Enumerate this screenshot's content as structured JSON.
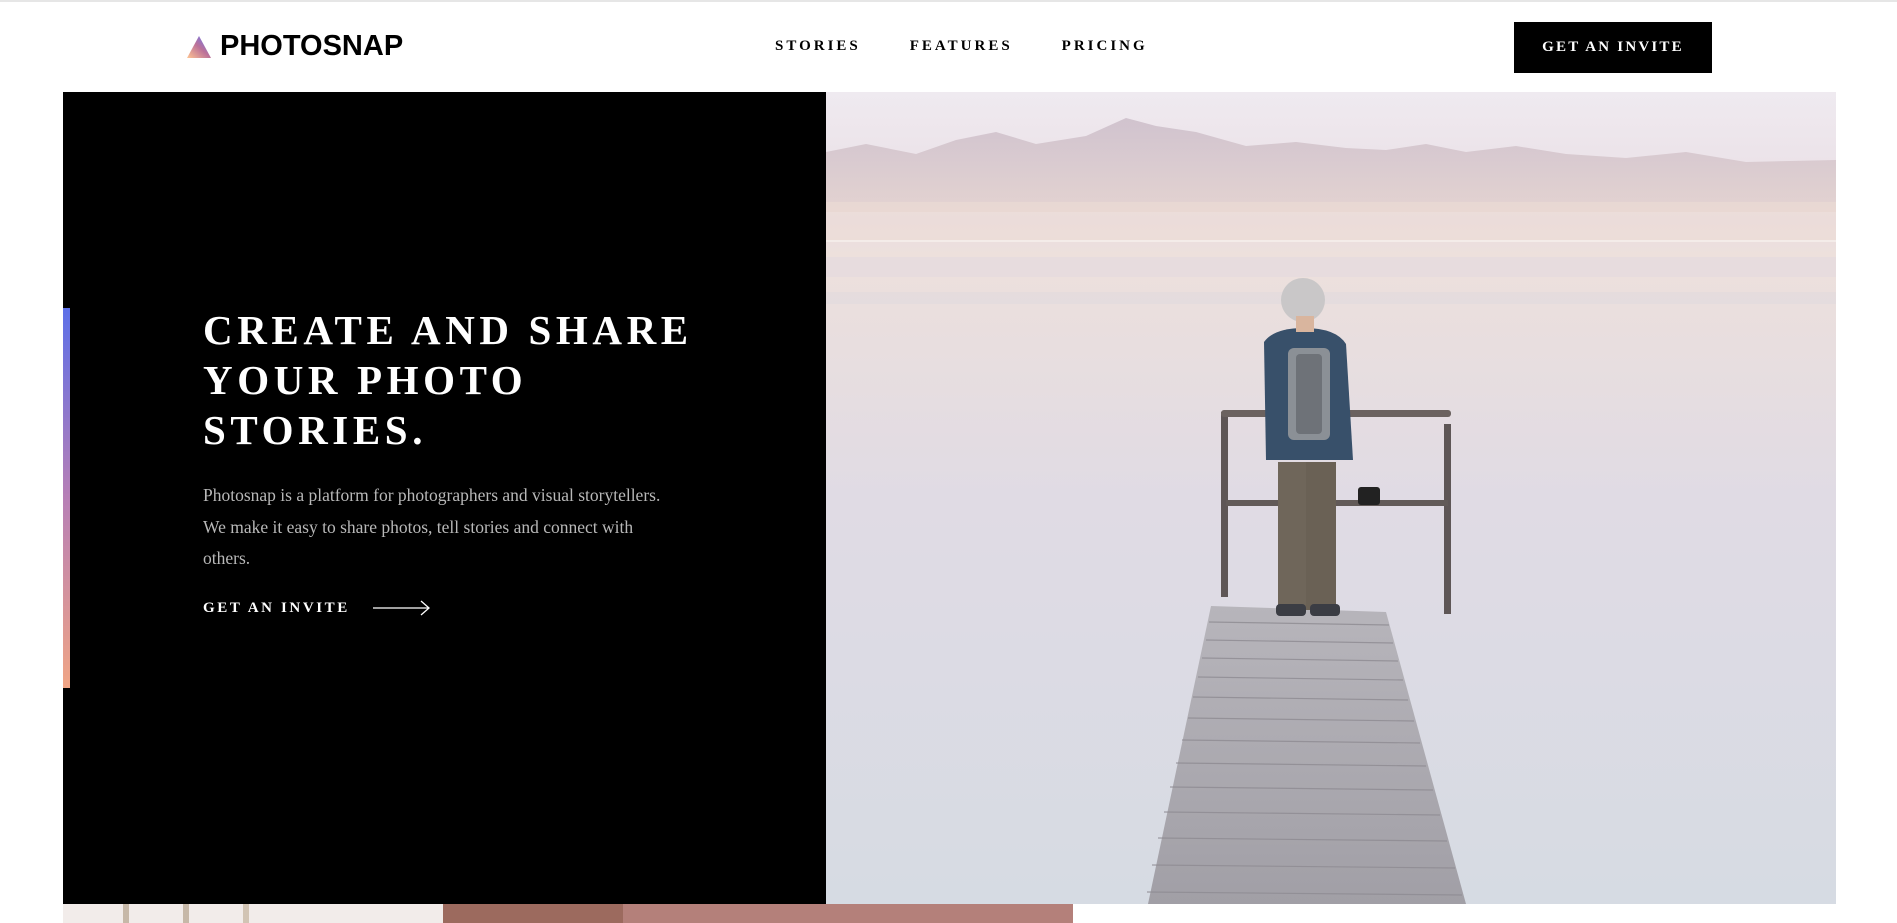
{
  "brand": {
    "name": "PHOTOSNAP",
    "logo_icon": "triangle-gradient-icon",
    "gradient": [
      "#ffc593",
      "#bc7198",
      "#5a77ff"
    ]
  },
  "nav": {
    "links": [
      {
        "label": "STORIES"
      },
      {
        "label": "FEATURES"
      },
      {
        "label": "PRICING"
      }
    ],
    "cta_label": "GET AN INVITE"
  },
  "hero": {
    "title": "CREATE AND SHARE YOUR PHOTO STORIES.",
    "text": "Photosnap is a platform for photographers and visual storytellers. We make it easy to share photos, tell stories and connect with others.",
    "cta_label": "GET AN INVITE",
    "cta_icon": "arrow-right-icon",
    "image_icon": "man-on-pier-photo"
  },
  "colors": {
    "accent_gradient": [
      "#5d70e8",
      "#b77fb6",
      "#f0a585"
    ],
    "background_dark": "#000000",
    "text_muted": "#b8b8b8"
  }
}
